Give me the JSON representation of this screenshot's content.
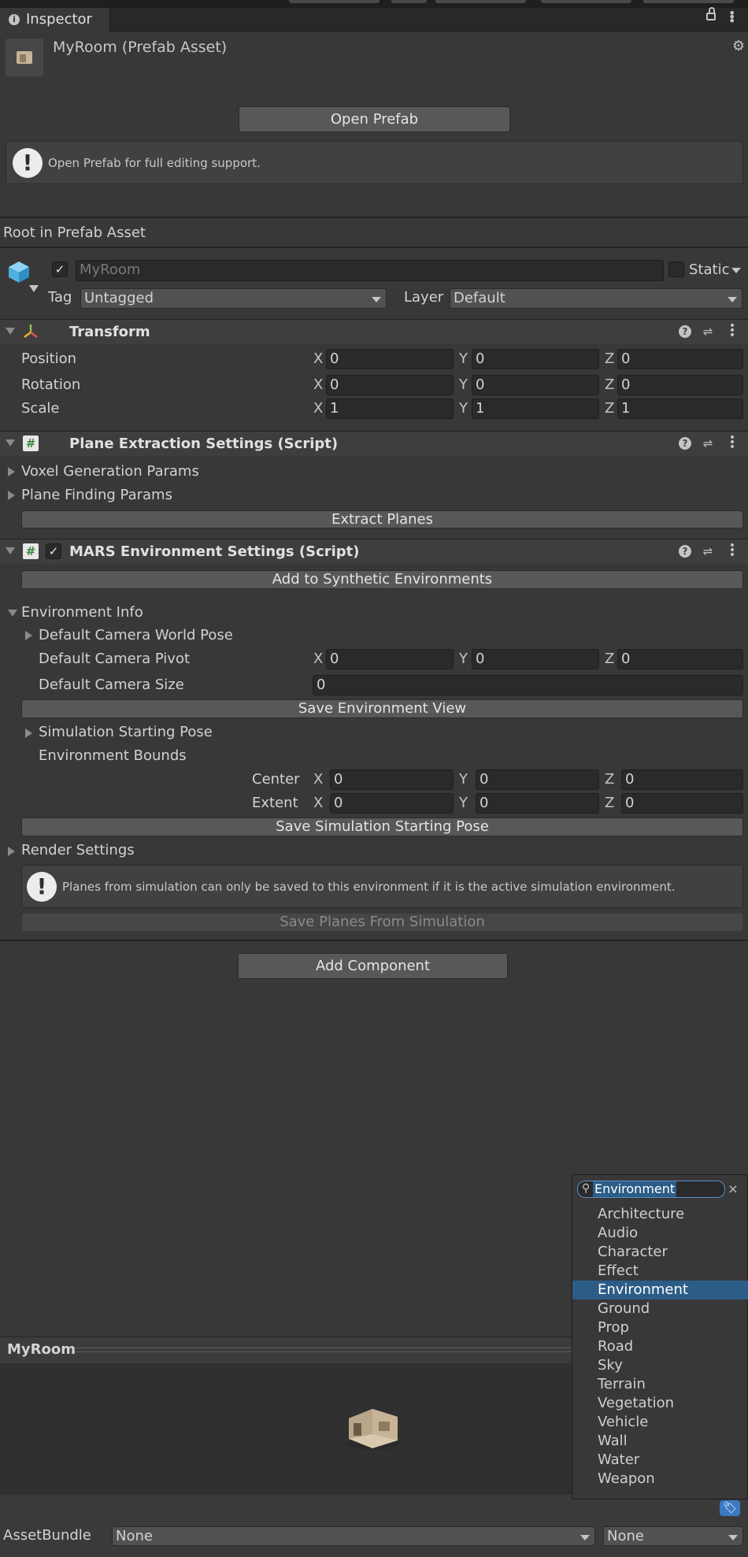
{
  "window": {
    "tab_label": "Inspector"
  },
  "header": {
    "title": "MyRoom (Prefab Asset)"
  },
  "prefab": {
    "open_button": "Open Prefab",
    "help_text": "Open Prefab for full editing support."
  },
  "root_label": "Root in Prefab Asset",
  "gameobject": {
    "name_placeholder": "MyRoom",
    "static_label": "Static",
    "tag_label": "Tag",
    "tag_value": "Untagged",
    "layer_label": "Layer",
    "layer_value": "Default"
  },
  "transform": {
    "title": "Transform",
    "rows": [
      {
        "label": "Position",
        "x": "0",
        "y": "0",
        "z": "0"
      },
      {
        "label": "Rotation",
        "x": "0",
        "y": "0",
        "z": "0"
      },
      {
        "label": "Scale",
        "x": "1",
        "y": "1",
        "z": "1"
      }
    ]
  },
  "axes": {
    "x": "X",
    "y": "Y",
    "z": "Z"
  },
  "plane_extraction": {
    "title": "Plane Extraction Settings (Script)",
    "voxel": "Voxel Generation Params",
    "plane_finding": "Plane Finding Params",
    "extract_button": "Extract Planes"
  },
  "mars": {
    "title": "MARS Environment Settings (Script)",
    "add_button": "Add to Synthetic Environments",
    "env_info": "Environment Info",
    "camera_world_pose": "Default Camera World Pose",
    "camera_pivot": {
      "label": "Default Camera Pivot",
      "x": "0",
      "y": "0",
      "z": "0"
    },
    "camera_size": {
      "label": "Default Camera Size",
      "value": "0"
    },
    "save_view_button": "Save Environment View",
    "sim_start_pose": "Simulation Starting Pose",
    "env_bounds": "Environment Bounds",
    "center": {
      "label": "Center",
      "x": "0",
      "y": "0",
      "z": "0"
    },
    "extent": {
      "label": "Extent",
      "x": "0",
      "y": "0",
      "z": "0"
    },
    "save_sim_button": "Save Simulation Starting Pose",
    "render_settings": "Render Settings",
    "planes_help": "Planes from simulation can only be saved to this environment if it is the active simulation environment.",
    "save_planes_button": "Save Planes From Simulation"
  },
  "add_component_button": "Add Component",
  "tag_dropdown": {
    "search_value": "Environment",
    "items": [
      "Architecture",
      "Audio",
      "Character",
      "Effect",
      "Environment",
      "Ground",
      "Prop",
      "Road",
      "Sky",
      "Terrain",
      "Vegetation",
      "Vehicle",
      "Wall",
      "Water",
      "Weapon"
    ],
    "selected": "Environment"
  },
  "preview": {
    "title": "MyRoom"
  },
  "asset_bundle": {
    "label": "AssetBundle",
    "name_value": "None",
    "variant_value": "None"
  },
  "colors": {
    "background": "#383838",
    "selection": "#2c5d87",
    "button": "#585858",
    "field": "#2a2a2a"
  }
}
